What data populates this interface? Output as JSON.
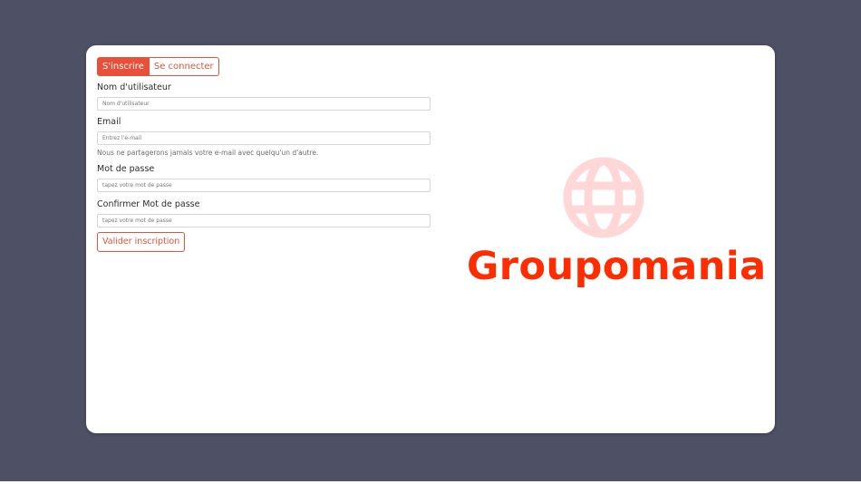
{
  "tabs": {
    "signup": "S'inscrire",
    "login": "Se connecter"
  },
  "form": {
    "username": {
      "label": "Nom d'utilisateur",
      "placeholder": "Nom d'utilisateur"
    },
    "email": {
      "label": "Email",
      "placeholder": "Entrez l'e-mail",
      "help": "Nous ne partagerons jamais votre e-mail avec quelqu'un d'autre."
    },
    "password": {
      "label": "Mot de passe",
      "placeholder": "tapez votre mot de passe"
    },
    "confirm": {
      "label": "Confirmer Mot de passe",
      "placeholder": "tapez votre mot de passe"
    },
    "submit_label": "Valider inscription"
  },
  "brand": {
    "name": "Groupomania",
    "icon": "globe-icon"
  },
  "colors": {
    "backdrop": "#4e5066",
    "accent": "#e8503a",
    "brand_red": "#fd2d01",
    "brand_pink": "#ffd7d7"
  }
}
